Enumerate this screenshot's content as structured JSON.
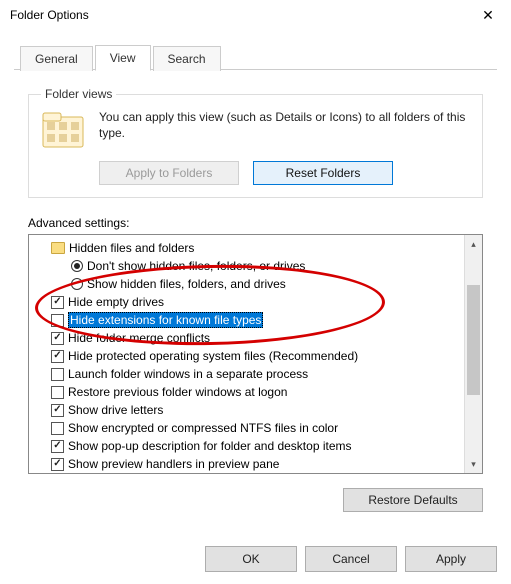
{
  "window": {
    "title": "Folder Options"
  },
  "tabs": {
    "general": "General",
    "view": "View",
    "search": "Search"
  },
  "folderviews": {
    "legend": "Folder views",
    "text": "You can apply this view (such as Details or Icons) to all folders of this type.",
    "apply_btn": "Apply to Folders",
    "reset_btn": "Reset Folders"
  },
  "advanced": {
    "label": "Advanced settings:",
    "items": [
      {
        "kind": "folder",
        "indent": 1,
        "label": "Hidden files and folders"
      },
      {
        "kind": "radio",
        "indent": 2,
        "selected": true,
        "label": "Don't show hidden files, folders, or drives"
      },
      {
        "kind": "radio",
        "indent": 2,
        "selected": false,
        "label": "Show hidden files, folders, and drives"
      },
      {
        "kind": "check",
        "indent": 1,
        "checked": true,
        "label": "Hide empty drives"
      },
      {
        "kind": "check",
        "indent": 1,
        "checked": false,
        "highlight": true,
        "label": "Hide extensions for known file types"
      },
      {
        "kind": "check",
        "indent": 1,
        "checked": true,
        "label": "Hide folder merge conflicts"
      },
      {
        "kind": "check",
        "indent": 1,
        "checked": true,
        "label": "Hide protected operating system files (Recommended)"
      },
      {
        "kind": "check",
        "indent": 1,
        "checked": false,
        "label": "Launch folder windows in a separate process"
      },
      {
        "kind": "check",
        "indent": 1,
        "checked": false,
        "label": "Restore previous folder windows at logon"
      },
      {
        "kind": "check",
        "indent": 1,
        "checked": true,
        "label": "Show drive letters"
      },
      {
        "kind": "check",
        "indent": 1,
        "checked": false,
        "label": "Show encrypted or compressed NTFS files in color"
      },
      {
        "kind": "check",
        "indent": 1,
        "checked": true,
        "label": "Show pop-up description for folder and desktop items"
      },
      {
        "kind": "check",
        "indent": 1,
        "checked": true,
        "label": "Show preview handlers in preview pane"
      }
    ],
    "restore_btn": "Restore Defaults"
  },
  "buttons": {
    "ok": "OK",
    "cancel": "Cancel",
    "apply": "Apply"
  }
}
